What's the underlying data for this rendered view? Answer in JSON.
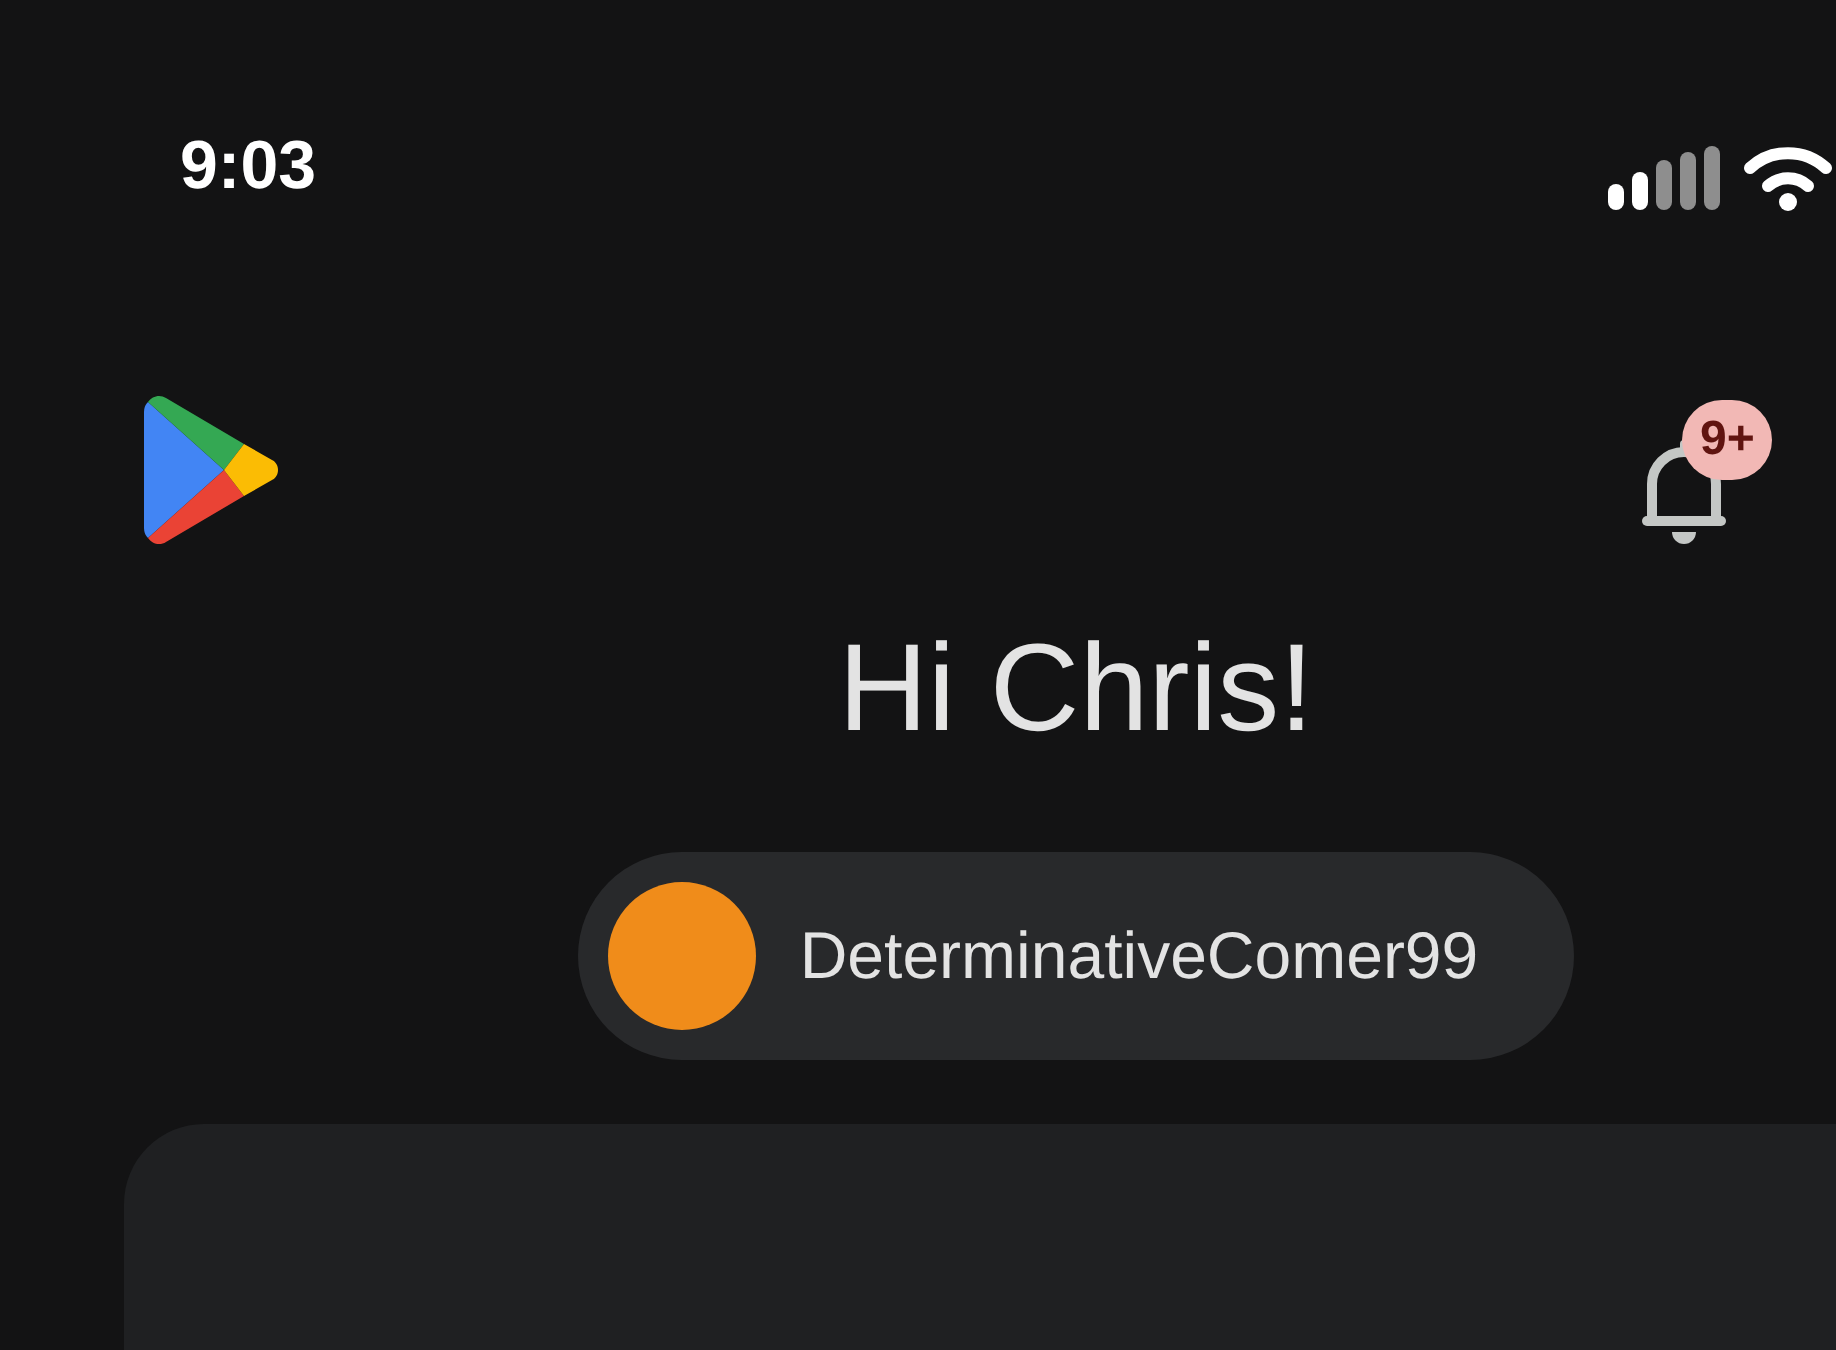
{
  "status_bar": {
    "time": "9:03"
  },
  "header": {
    "notifications": {
      "badge": "9+"
    }
  },
  "greeting": "Hi Chris!",
  "account": {
    "name": "DeterminativeComer99"
  }
}
